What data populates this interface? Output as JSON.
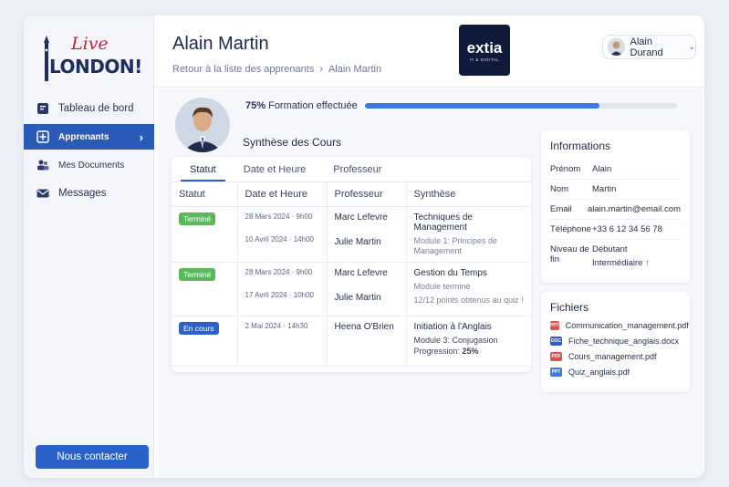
{
  "brand": {
    "logo_live": "Live",
    "logo_london": "LONDON!"
  },
  "sidebar": {
    "items": [
      {
        "label": "Tableau de bord",
        "icon": "dashboard-icon"
      },
      {
        "label": "Apprenants",
        "icon": "plus-square-icon",
        "active": true
      },
      {
        "label": "Mes Documents",
        "icon": "users-icon"
      },
      {
        "label": "Messages",
        "icon": "mail-icon"
      }
    ],
    "contact_label": "Nous contacter"
  },
  "header": {
    "title": "Alain Martin",
    "breadcrumb_back": "Retour à la liste des apprenants",
    "breadcrumb_current": "Alain Martin",
    "company_name": "extia",
    "company_tagline": "IT & DIGITAL",
    "user_name": "Alain Durand"
  },
  "progress": {
    "percent_label": "75%",
    "label": "Formation effectuée",
    "value": 0.75
  },
  "courses": {
    "section_title": "Synthèse des Cours",
    "tabs": [
      "Statut",
      "Date et Heure",
      "Professeur"
    ],
    "columns": [
      "Statut",
      "Date et Heure",
      "Professeur",
      "Synthèse"
    ],
    "rows": [
      {
        "status": "Terminé",
        "dates": [
          "28 Mars 2024 · 9h00",
          "10 Avril 2024 · 14h00"
        ],
        "profs": [
          "Marc Lefevre",
          "Julie Martin"
        ],
        "title": "Techniques de Management",
        "details": [
          "Module 1: Principes de Management"
        ]
      },
      {
        "status": "Terminé",
        "dates": [
          "28 Mars 2024 · 9h00",
          "17 Avril 2024 · 10h00"
        ],
        "profs": [
          "Marc Lefevre",
          "Julie Martin"
        ],
        "title": "Gestion du Temps",
        "details": [
          "Module terminé",
          "12/12 points obtenus au quiz !"
        ]
      },
      {
        "status": "En cours",
        "dates": [
          "2 Mai 2024 · 14h30"
        ],
        "profs": [
          "Heena O'Brien"
        ],
        "title": "Initiation à l'Anglais",
        "details": [
          "Module 3: Conjugasion"
        ],
        "progress_label": "Progression:",
        "progress_value": "25%"
      }
    ]
  },
  "info": {
    "title": "Informations",
    "rows": [
      {
        "key": "Prénom",
        "value": "Alain"
      },
      {
        "key": "Nom",
        "value": "Martin"
      },
      {
        "key": "Email",
        "value": "alain.martin@email.com"
      },
      {
        "key": "Téléphone",
        "value": "+33 6 12 34 56 78"
      }
    ],
    "level_key": "Niveau de fin",
    "level_from": "Débutant",
    "level_to": "Intermédiaire",
    "level_arrow": "↑"
  },
  "files": {
    "title": "Fichiers",
    "items": [
      {
        "name": "Communication_management.pdf",
        "type": "PPT"
      },
      {
        "name": "Fiche_technique_anglais.docx",
        "type": "DOC"
      },
      {
        "name": "Cours_management.pdf",
        "type": "PDF"
      },
      {
        "name": "Quiz_anglais.pdf",
        "type": "PPT"
      }
    ]
  },
  "colors": {
    "accent": "#2a62c9",
    "done": "#5cb85c",
    "brand_red": "#c62633",
    "brand_navy": "#1d2f5e"
  }
}
